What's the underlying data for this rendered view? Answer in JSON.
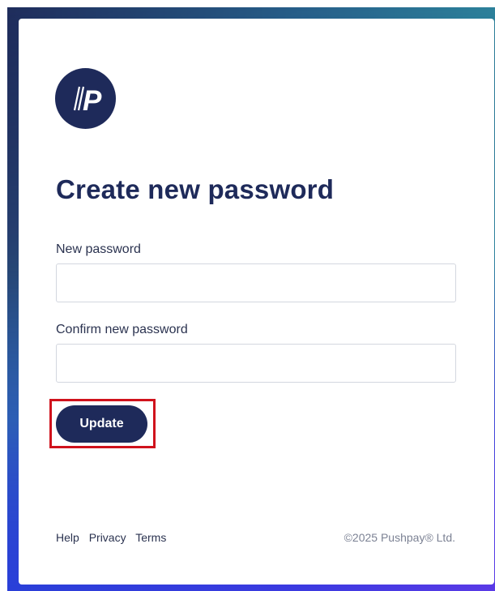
{
  "brand": {
    "logo_icon": "pushpay-logo-icon",
    "logo_text": "//P",
    "color": "#1e2a5a"
  },
  "form": {
    "title": "Create new password",
    "new_password_label": "New password",
    "new_password_value": "",
    "confirm_password_label": "Confirm new password",
    "confirm_password_value": "",
    "submit_label": "Update"
  },
  "footer": {
    "links": [
      "Help",
      "Privacy",
      "Terms"
    ],
    "copyright": "©2025 Pushpay® Ltd."
  },
  "annotation": {
    "highlight_color": "#d0121c",
    "highlight_target": "Update"
  }
}
